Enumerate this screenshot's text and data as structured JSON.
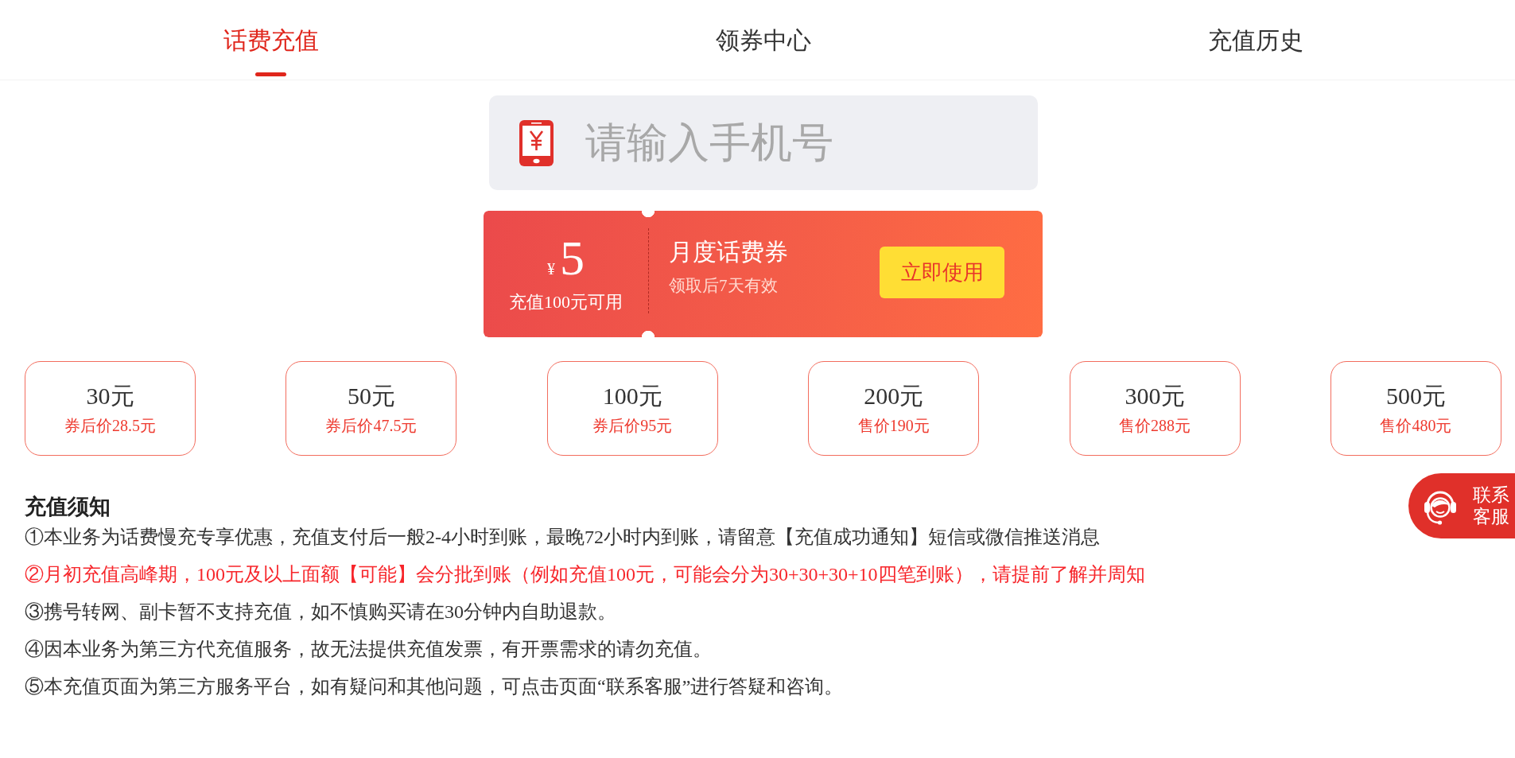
{
  "tabs": [
    {
      "label": "话费充值",
      "selected": true
    },
    {
      "label": "领券中心",
      "selected": false
    },
    {
      "label": "充值历史",
      "selected": false
    }
  ],
  "phone_input": {
    "placeholder": "请输入手机号"
  },
  "coupon": {
    "currency": "¥",
    "amount": "5",
    "condition": "充值100元可用",
    "title": "月度话费券",
    "validity": "领取后7天有效",
    "button": "立即使用"
  },
  "amounts": [
    {
      "face_value": "30元",
      "price": "券后价28.5元",
      "selected": false
    },
    {
      "face_value": "50元",
      "price": "券后价47.5元",
      "selected": false
    },
    {
      "face_value": "100元",
      "price": "券后价95元",
      "selected": false
    },
    {
      "face_value": "200元",
      "price": "售价190元",
      "selected": false
    },
    {
      "face_value": "300元",
      "price": "售价288元",
      "selected": false
    },
    {
      "face_value": "500元",
      "price": "售价480元",
      "selected": false
    }
  ],
  "notice": {
    "title": "充值须知",
    "items": [
      {
        "text": "①本业务为话费慢充专享优惠，充值支付后一般2-4小时到账，最晚72小时内到账，请留意【充值成功通知】短信或微信推送消息",
        "highlighted": false
      },
      {
        "text": "②月初充值高峰期，100元及以上面额【可能】会分批到账（例如充值100元，可能会分为30+30+30+10四笔到账），请提前了解并周知",
        "highlighted": true
      },
      {
        "text": "③携号转网、副卡暂不支持充值，如不慎购买请在30分钟内自助退款。",
        "highlighted": false
      },
      {
        "text": "④因本业务为第三方代充值服务，故无法提供充值发票，有开票需求的请勿充值。",
        "highlighted": false
      },
      {
        "text": "⑤本充值页面为第三方服务平台，如有疑问和其他问题，可点击页面“联系客服”进行答疑和咨询。",
        "highlighted": false
      }
    ]
  },
  "service_button": {
    "label": "联系客服"
  }
}
